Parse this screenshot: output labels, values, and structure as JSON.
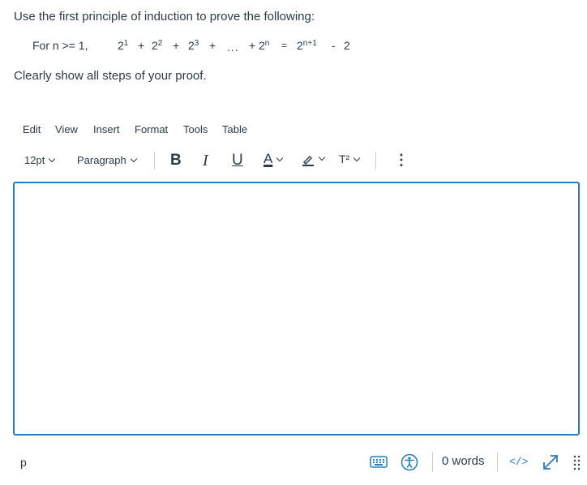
{
  "question": {
    "instruction": "Use the first principle of induction to prove the following:",
    "formula": {
      "prefix": "For n >= 1,",
      "t1_base": "2",
      "t1_exp": "1",
      "plus1": "+",
      "t2_base": "2",
      "t2_exp": "2",
      "plus2": "+",
      "t3_base": "2",
      "t3_exp": "3",
      "plus3": "+",
      "ellipsis": "...",
      "plus4": "+",
      "tn_base": "2",
      "tn_exp": "n",
      "equals": "=",
      "rhs_base": "2",
      "rhs_exp": "n+1",
      "minus": "-",
      "rhs_const": "2"
    },
    "note": "Clearly show all steps of your proof."
  },
  "editor": {
    "menu": [
      "Edit",
      "View",
      "Insert",
      "Format",
      "Tools",
      "Table"
    ],
    "toolbar": {
      "font_size": "12pt",
      "block_format": "Paragraph",
      "bold": "B",
      "italic": "I",
      "underline": "U",
      "text_color": "A",
      "superscript": "T²",
      "more": "⋮"
    },
    "content": "",
    "statusbar": {
      "path": "p",
      "word_count": "0 words",
      "html_toggle": "</>"
    }
  },
  "colors": {
    "accent": "#2b7abc",
    "text": "#2d3b45",
    "divider": "#c7cdd1"
  }
}
